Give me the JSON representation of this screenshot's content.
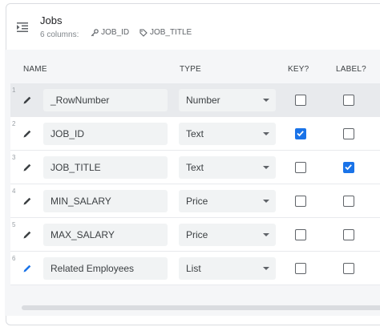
{
  "table": {
    "title": "Jobs",
    "columns_count": "6 columns:",
    "key_tags": [
      {
        "icon": "key-icon",
        "label": "JOB_ID"
      },
      {
        "icon": "tag-icon",
        "label": "JOB_TITLE"
      }
    ]
  },
  "headers": {
    "name": "NAME",
    "type": "TYPE",
    "key": "KEY?",
    "label": "LABEL?"
  },
  "rows": [
    {
      "num": "1",
      "name": "_RowNumber",
      "type": "Number",
      "key": false,
      "label": false,
      "edit_icon": "pencil-icon"
    },
    {
      "num": "2",
      "name": "JOB_ID",
      "type": "Text",
      "key": true,
      "label": false,
      "edit_icon": "pencil-icon"
    },
    {
      "num": "3",
      "name": "JOB_TITLE",
      "type": "Text",
      "key": false,
      "label": true,
      "edit_icon": "pencil-icon"
    },
    {
      "num": "4",
      "name": "MIN_SALARY",
      "type": "Price",
      "key": false,
      "label": false,
      "edit_icon": "pencil-icon"
    },
    {
      "num": "5",
      "name": "MAX_SALARY",
      "type": "Price",
      "key": false,
      "label": false,
      "edit_icon": "pencil-icon"
    },
    {
      "num": "6",
      "name": "Related Employees",
      "type": "List",
      "key": false,
      "label": false,
      "edit_icon": "pencil-icon"
    }
  ],
  "colors": {
    "accent": "#1a73e8",
    "virtual_edit_icon": "#1a73e8"
  }
}
